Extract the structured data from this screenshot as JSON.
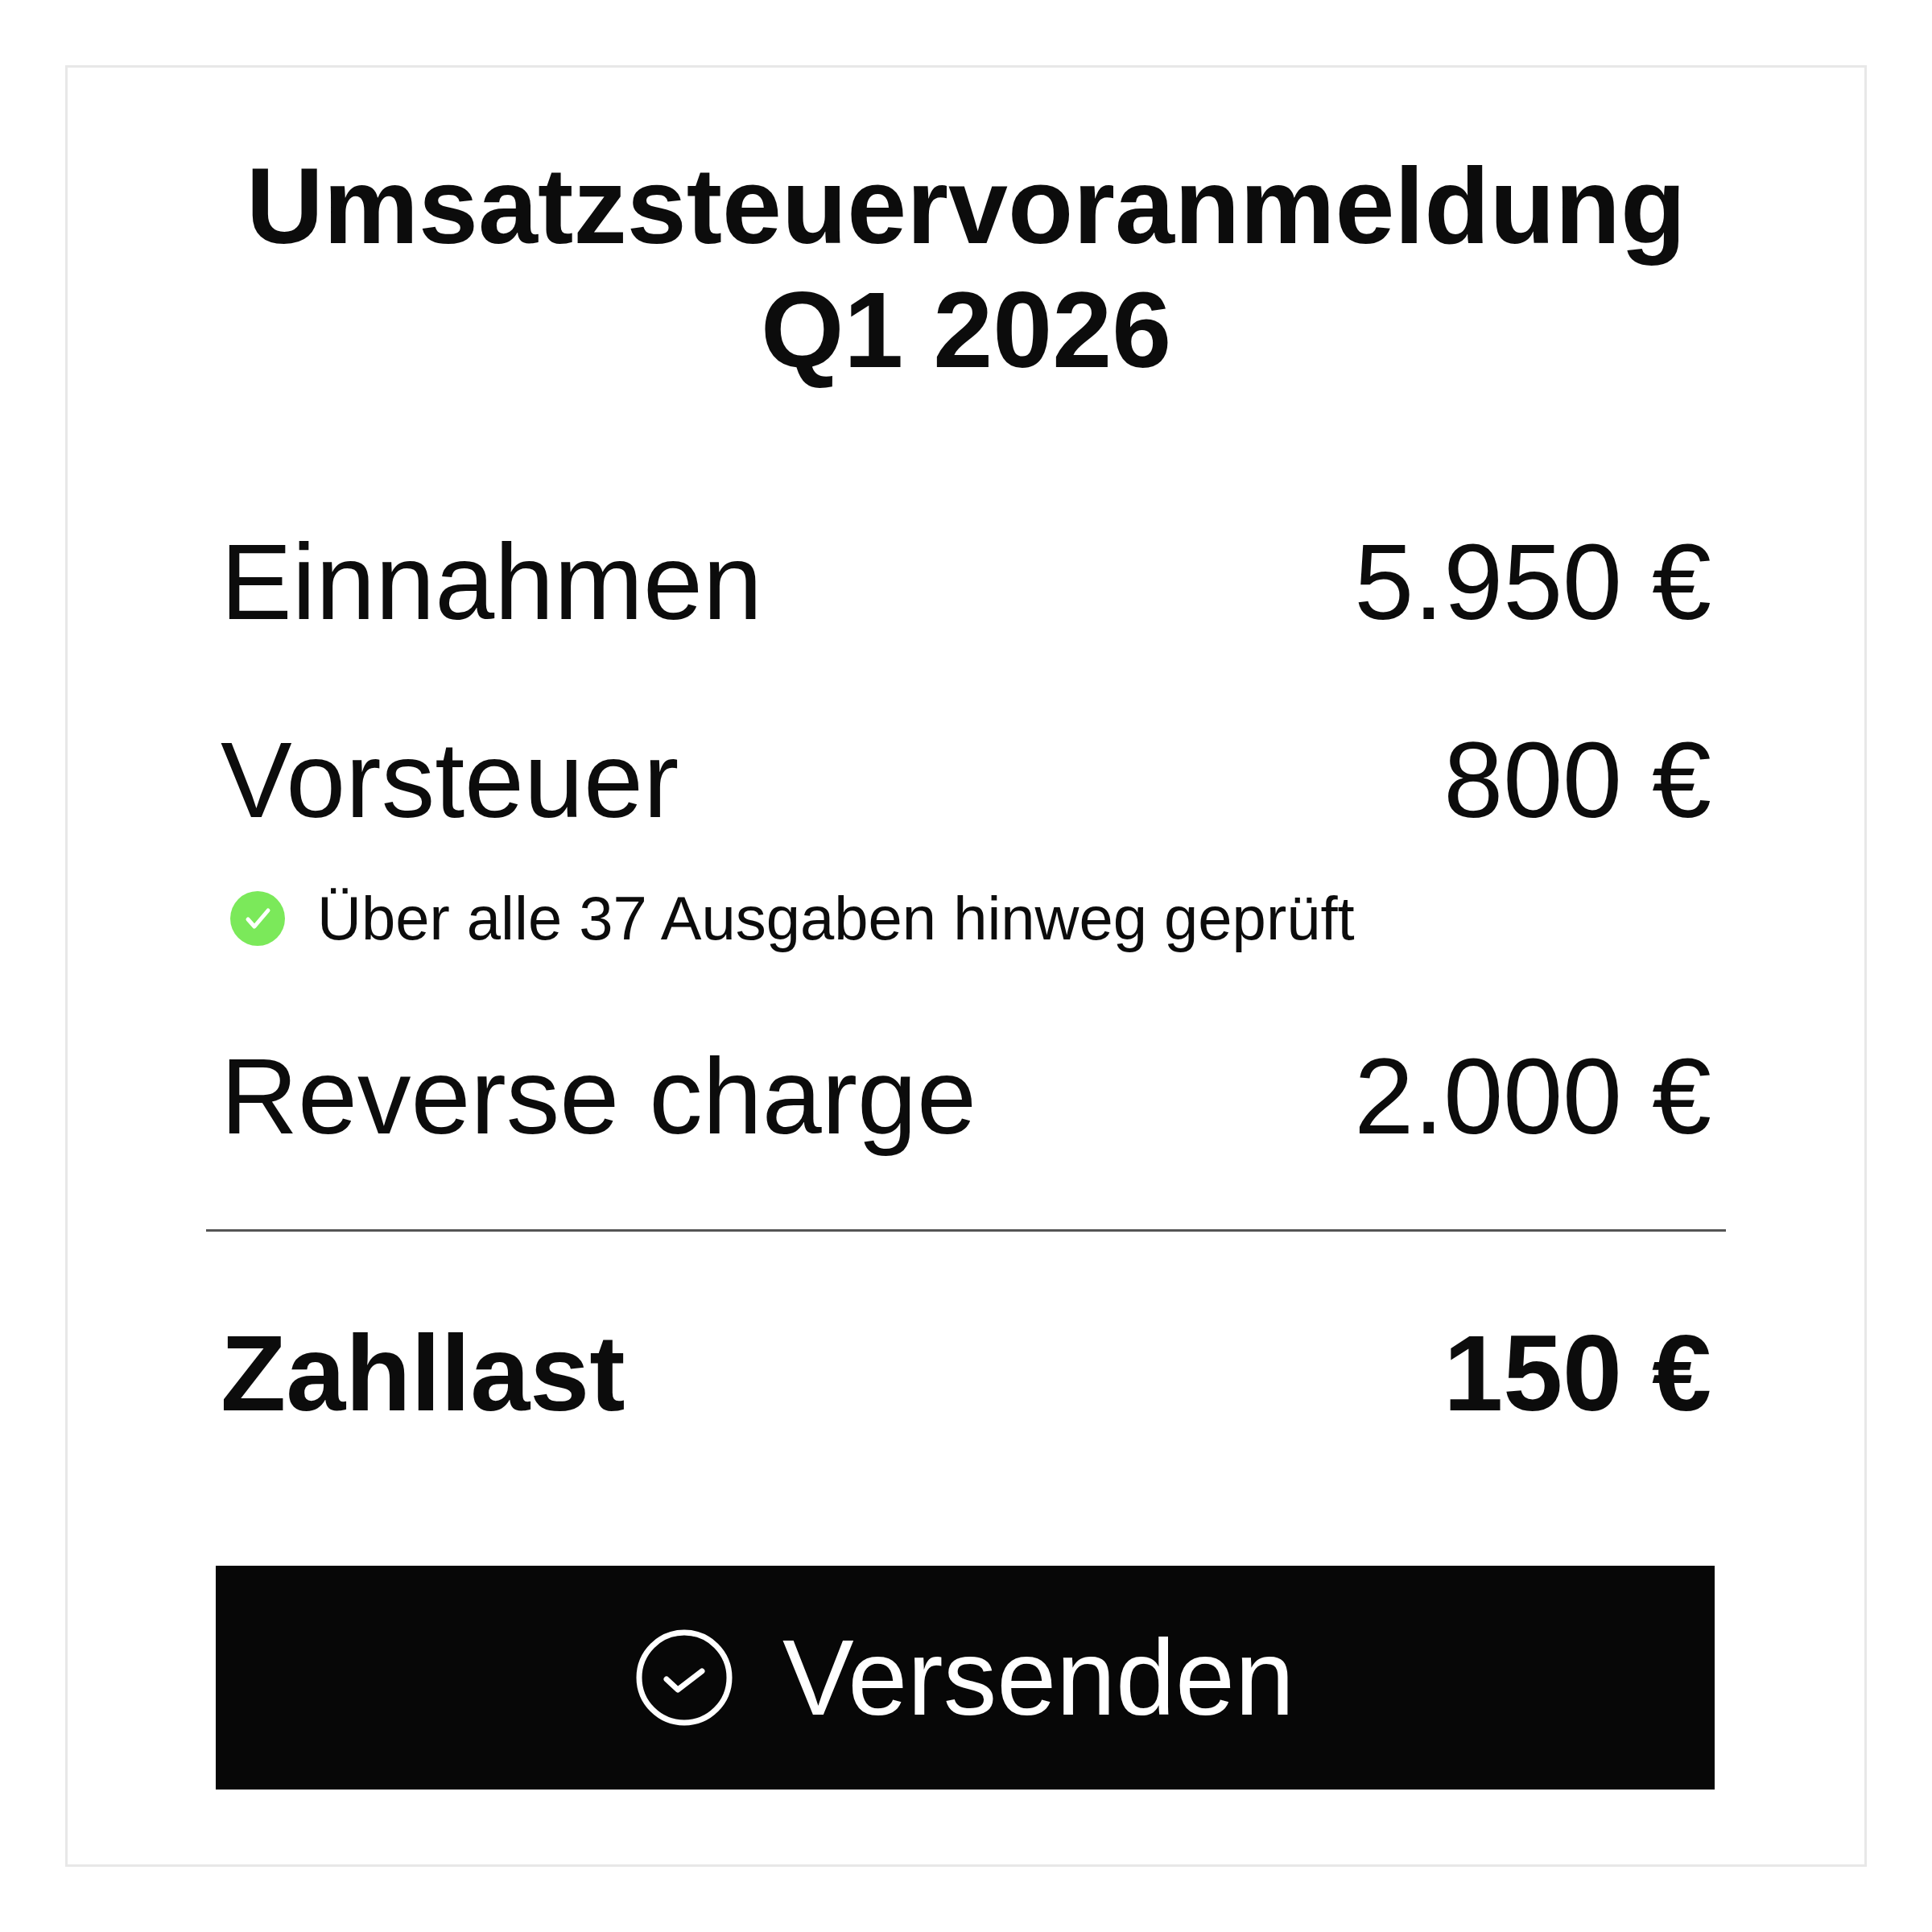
{
  "title": "Umsatzsteuervoranmeldung Q1 2026",
  "items": [
    {
      "kind": "line",
      "label": "Einnahmen",
      "amount": "5.950 €"
    },
    {
      "kind": "line",
      "label": "Vorsteuer",
      "amount": "800 €"
    },
    {
      "kind": "note",
      "text": "Über alle 37 Ausgaben hinweg geprüft",
      "color": "#7be95a"
    },
    {
      "kind": "line",
      "label": "Reverse charge",
      "amount": "2.000 €"
    }
  ],
  "total": {
    "label": "Zahllast",
    "amount": "150 €"
  },
  "button": {
    "label": "Versenden"
  }
}
